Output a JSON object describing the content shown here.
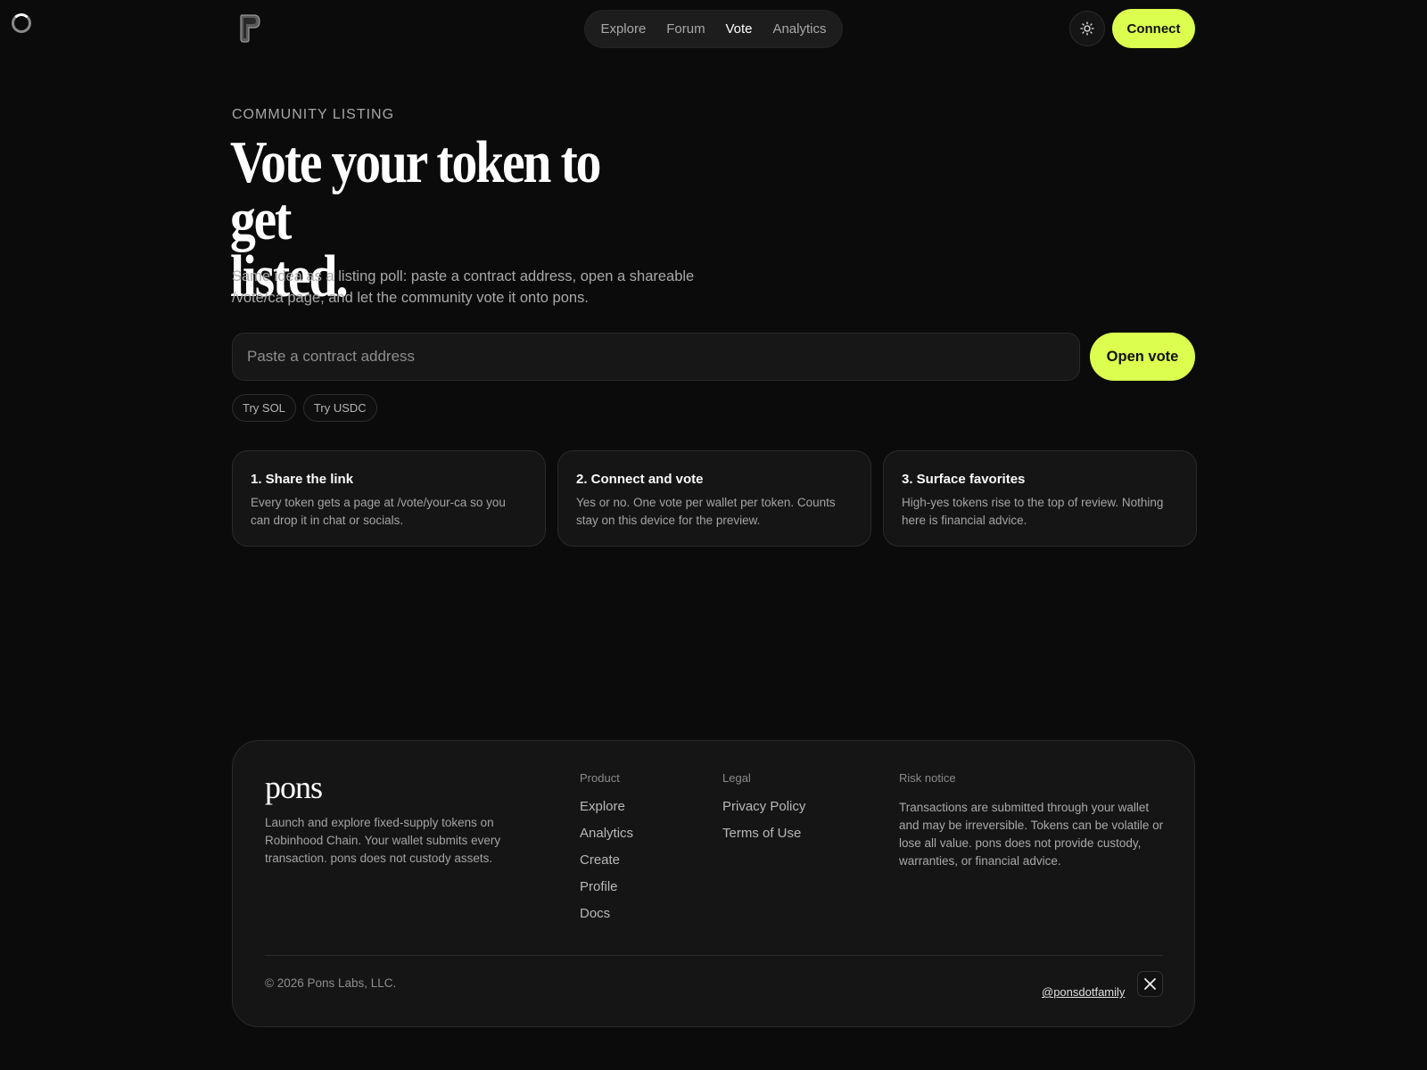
{
  "header": {
    "nav": [
      "Explore",
      "Forum",
      "Vote",
      "Analytics"
    ],
    "active_nav": "Vote",
    "connect_label": "Connect",
    "icons": {
      "logo": "pons-logo",
      "theme": "sun-icon"
    }
  },
  "hero": {
    "eyebrow": "COMMUNITY LISTING",
    "title_line1": "Vote your token to get",
    "title_line2": "listed.",
    "description": "Same idea as a listing poll: paste a contract address, open a shareable /vote/ca page, and let the community vote it onto pons.",
    "input_placeholder": "Paste a contract address",
    "open_vote_label": "Open vote",
    "chips": [
      "Try SOL",
      "Try USDC"
    ]
  },
  "steps": [
    {
      "title": "1. Share the link",
      "body": "Every token gets a page at /vote/your-ca so you can drop it in chat or socials."
    },
    {
      "title": "2. Connect and vote",
      "body": "Yes or no. One vote per wallet per token. Counts stay on this device for the preview."
    },
    {
      "title": "3. Surface favorites",
      "body": "High-yes tokens rise to the top of review. Nothing here is financial advice."
    }
  ],
  "footer": {
    "brand": "pons",
    "about": "Launch and explore fixed-supply tokens on Robinhood Chain. Your wallet submits every transaction. pons does not custody assets.",
    "product_head": "Product",
    "product_links": [
      "Explore",
      "Analytics",
      "Create",
      "Profile",
      "Docs"
    ],
    "legal_head": "Legal",
    "legal_links": [
      "Privacy Policy",
      "Terms of Use"
    ],
    "risk_head": "Risk notice",
    "risk_text": "Transactions are submitted through your wallet and may be irreversible. Tokens can be volatile or lose all value. pons does not provide custody, warranties, or financial advice.",
    "copyright": "© 2026 Pons Labs, LLC.",
    "social_handle": "@ponsdotfamily"
  },
  "colors": {
    "accent": "#dcff4f",
    "background": "#0b0b0b",
    "card": "#151515"
  }
}
